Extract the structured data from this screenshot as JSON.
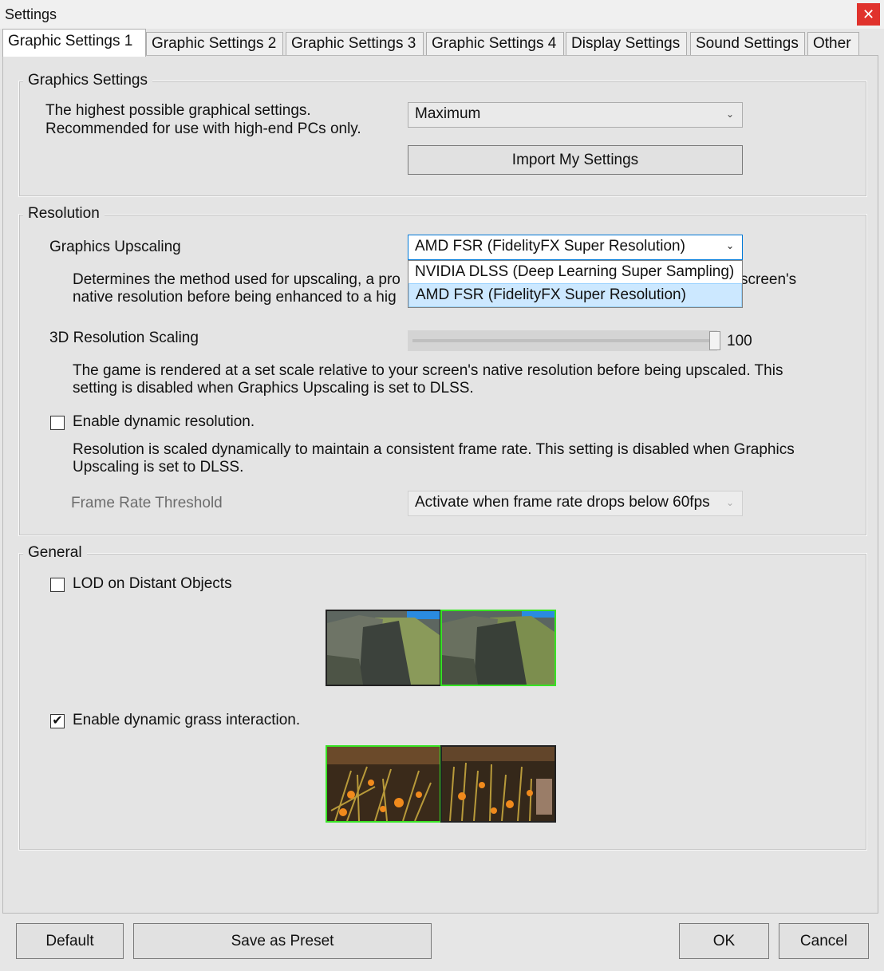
{
  "window": {
    "title": "Settings",
    "close_glyph": "✕"
  },
  "tabs": [
    {
      "label": "Graphic Settings 1",
      "active": true
    },
    {
      "label": "Graphic Settings 2"
    },
    {
      "label": "Graphic Settings 3"
    },
    {
      "label": "Graphic Settings 4"
    },
    {
      "label": "Display Settings"
    },
    {
      "label": "Sound Settings"
    },
    {
      "label": "Other"
    }
  ],
  "graphics": {
    "title": "Graphics Settings",
    "desc1": "The highest possible graphical settings.",
    "desc2": "Recommended for use with high-end PCs only.",
    "preset_value": "Maximum",
    "import_label": "Import My Settings"
  },
  "resolution": {
    "title": "Resolution",
    "upscaling_label": "Graphics Upscaling",
    "upscaling_value": "AMD FSR (FidelityFX Super Resolution)",
    "upscaling_options": [
      "NVIDIA DLSS (Deep Learning Super Sampling)",
      "AMD FSR (FidelityFX Super Resolution)"
    ],
    "upscaling_desc1": "Determines the method used for upscaling, a pro",
    "upscaling_desc1_tail": "screen's",
    "upscaling_desc2": "native resolution before being enhanced to a hig",
    "scaling_label": "3D Resolution Scaling",
    "scaling_value": "100",
    "scaling_level": 1.0,
    "scaling_desc1": "The game is rendered at a set scale relative to your screen's native resolution before being upscaled. This",
    "scaling_desc2": "setting is disabled when Graphics Upscaling is set to DLSS.",
    "dynamic_label": "Enable dynamic resolution.",
    "dynamic_checked": false,
    "dynamic_desc1": "Resolution is scaled dynamically to maintain a consistent frame rate. This setting is disabled when Graphics",
    "dynamic_desc2": "Upscaling is set to DLSS.",
    "threshold_label": "Frame Rate Threshold",
    "threshold_value": "Activate when frame rate drops below 60fps"
  },
  "general": {
    "title": "General",
    "lod_label": "LOD on Distant Objects",
    "lod_checked": false,
    "grass_label": "Enable dynamic grass interaction.",
    "grass_checked": true,
    "check_glyph": "✔"
  },
  "footer": {
    "default_label": "Default",
    "preset_label": "Save as Preset",
    "ok_label": "OK",
    "cancel_label": "Cancel"
  }
}
